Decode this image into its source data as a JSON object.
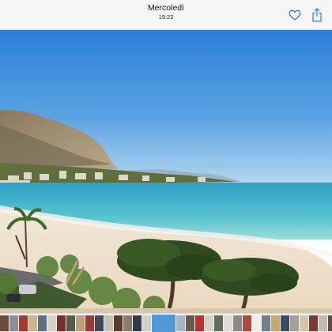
{
  "header": {
    "title": "Mercoledì",
    "time": "19:22"
  },
  "actions": {
    "favorite_icon": "heart-icon",
    "share_icon": "share-icon",
    "accent": "#3478f6"
  },
  "filmstrip": {
    "current_index": 16,
    "thumbnail_colors": [
      "#6b4a3a",
      "#8a8f99",
      "#a33a2e",
      "#c9b48e",
      "#5d6f83",
      "#d8d2c4",
      "#7a2f2a",
      "#4f5d4a",
      "#b8a27c",
      "#9a3b35",
      "#3e4a5c",
      "#c7c0b5",
      "#5a3a2c",
      "#8b7b6a",
      "#2f3a48",
      "#d5cfc6",
      "#4f9ad6",
      "#a4b6c9",
      "#6a5a4c",
      "#c3302c",
      "#d9d2c0",
      "#5e6e58",
      "#e0dcd0",
      "#8e8a84",
      "#b04a3a",
      "#f0eee8",
      "#6f7f90",
      "#c8a86a",
      "#3a4c66",
      "#a69e92",
      "#d2c5a8",
      "#7d3b2d",
      "#c0b9ae",
      "#5c4a40",
      "#e6e2da",
      "#8aa2bf",
      "#b33c30"
    ]
  }
}
